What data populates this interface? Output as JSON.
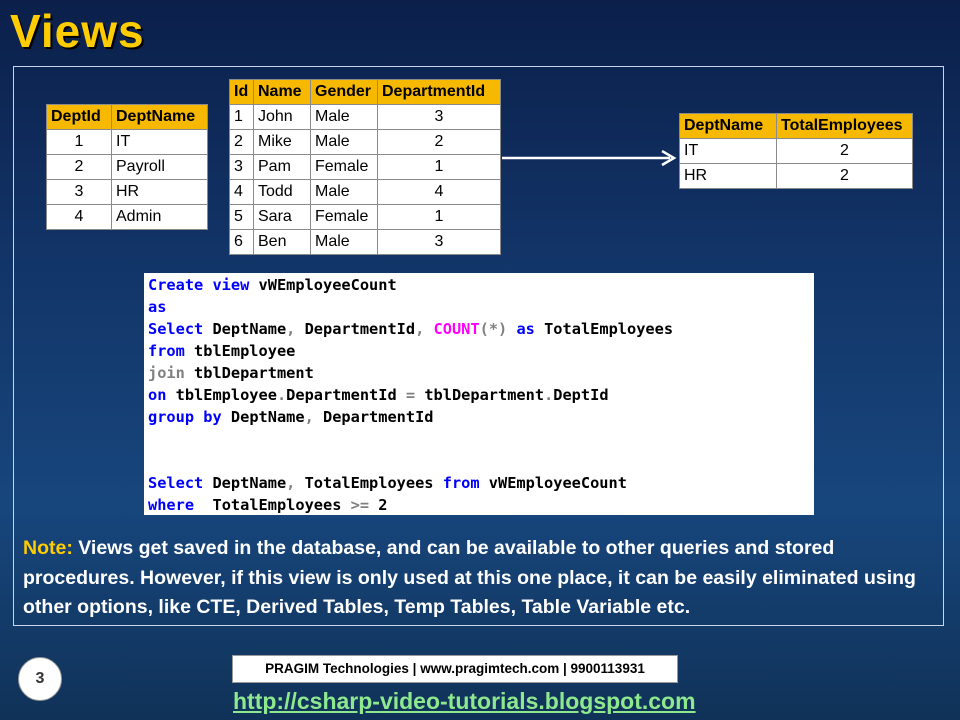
{
  "title": "Views",
  "dept_table": {
    "headers": [
      "DeptId",
      "DeptName"
    ],
    "rows": [
      [
        "1",
        "IT"
      ],
      [
        "2",
        "Payroll"
      ],
      [
        "3",
        "HR"
      ],
      [
        "4",
        "Admin"
      ]
    ]
  },
  "emp_table": {
    "headers": [
      "Id",
      "Name",
      "Gender",
      "DepartmentId"
    ],
    "rows": [
      [
        "1",
        "John",
        "Male",
        "3"
      ],
      [
        "2",
        "Mike",
        "Male",
        "2"
      ],
      [
        "3",
        "Pam",
        "Female",
        "1"
      ],
      [
        "4",
        "Todd",
        "Male",
        "4"
      ],
      [
        "5",
        "Sara",
        "Female",
        "1"
      ],
      [
        "6",
        "Ben",
        "Male",
        "3"
      ]
    ]
  },
  "result_table": {
    "headers": [
      "DeptName",
      "TotalEmployees"
    ],
    "rows": [
      [
        "IT",
        "2"
      ],
      [
        "HR",
        "2"
      ]
    ]
  },
  "code_lines": [
    [
      [
        "kw",
        "Create view"
      ],
      [
        "",
        " vWEmployeeCount"
      ]
    ],
    [
      [
        "kw",
        "as"
      ]
    ],
    [
      [
        "kw",
        "Select"
      ],
      [
        "",
        " DeptName"
      ],
      [
        "gr",
        ","
      ],
      [
        "",
        " DepartmentId"
      ],
      [
        "gr",
        ","
      ],
      [
        "",
        " "
      ],
      [
        "fn",
        "COUNT"
      ],
      [
        "gr",
        "(*)"
      ],
      [
        "",
        " "
      ],
      [
        "kw",
        "as"
      ],
      [
        "",
        " TotalEmployees"
      ]
    ],
    [
      [
        "kw",
        "from"
      ],
      [
        "",
        " tblEmployee"
      ]
    ],
    [
      [
        "gr",
        "join"
      ],
      [
        "",
        " tblDepartment"
      ]
    ],
    [
      [
        "kw",
        "on"
      ],
      [
        "",
        " tblEmployee"
      ],
      [
        "gr",
        "."
      ],
      [
        "",
        "DepartmentId "
      ],
      [
        "gr",
        "="
      ],
      [
        "",
        " tblDepartment"
      ],
      [
        "gr",
        "."
      ],
      [
        "",
        "DeptId"
      ]
    ],
    [
      [
        "kw",
        "group by"
      ],
      [
        "",
        " DeptName"
      ],
      [
        "gr",
        ","
      ],
      [
        "",
        " DepartmentId"
      ]
    ],
    [],
    [],
    [
      [
        "kw",
        "Select"
      ],
      [
        "",
        " DeptName"
      ],
      [
        "gr",
        ","
      ],
      [
        "",
        " TotalEmployees "
      ],
      [
        "kw",
        "from"
      ],
      [
        "",
        " vWEmployeeCount"
      ]
    ],
    [
      [
        "kw",
        "where"
      ],
      [
        "",
        "  TotalEmployees "
      ],
      [
        "gr",
        ">="
      ],
      [
        "",
        " 2"
      ]
    ]
  ],
  "note": {
    "label": "Note:",
    "text": "Views get saved in the database, and can be available to other queries and stored procedures. However, if this view is only used at this one place, it can be easily eliminated using other options, like CTE, Derived Tables, Temp Tables, Table Variable etc."
  },
  "page_number": "3",
  "footer_text": "PRAGIM Technologies | www.pragimtech.com | 9900113931",
  "url": "http://csharp-video-tutorials.blogspot.com",
  "colors": {
    "title": "#ffcc00",
    "header_fill": "#f7b900",
    "keyword": "#0000ff",
    "operator": "#808080",
    "function": "#ff00ff",
    "url": "#8ee88e"
  }
}
